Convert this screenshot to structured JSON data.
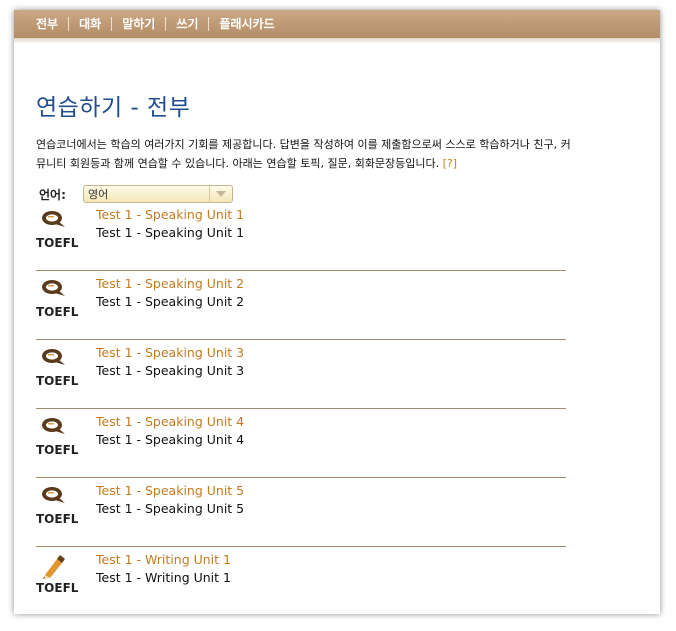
{
  "nav": {
    "items": [
      "전부",
      "대화",
      "말하기",
      "쓰기",
      "플래시카드"
    ]
  },
  "page": {
    "title": "연습하기 - 전부",
    "intro_line1": "연습코너에서는 학습의 여러가지 기회를 제공합니다. 답변을 작성하여 이를 제출함으로써 스스로 학습하거나 친구, 커",
    "intro_line2": "뮤니티 회원등과 함께 연습할 수 있습니다. 아래는 연습할 토픽, 질문, 회화문장등입니다.",
    "help_link": "[?]"
  },
  "language": {
    "label": "언어:",
    "selected": "영어"
  },
  "items": [
    {
      "icon": "speech-bubble-icon",
      "type": "TOEFL",
      "title": "Test 1 - Speaking Unit 1",
      "subtitle": "Test 1 - Speaking Unit 1"
    },
    {
      "icon": "speech-bubble-icon",
      "type": "TOEFL",
      "title": "Test 1 - Speaking Unit 2",
      "subtitle": "Test 1 - Speaking Unit 2"
    },
    {
      "icon": "speech-bubble-icon",
      "type": "TOEFL",
      "title": "Test 1 - Speaking Unit 3",
      "subtitle": "Test 1 - Speaking Unit 3"
    },
    {
      "icon": "speech-bubble-icon",
      "type": "TOEFL",
      "title": "Test 1 - Speaking Unit 4",
      "subtitle": "Test 1 - Speaking Unit 4"
    },
    {
      "icon": "speech-bubble-icon",
      "type": "TOEFL",
      "title": "Test 1 - Speaking Unit 5",
      "subtitle": "Test 1 - Speaking Unit 5"
    },
    {
      "icon": "pencil-icon",
      "type": "TOEFL",
      "title": "Test 1 - Writing Unit 1",
      "subtitle": "Test 1 - Writing Unit 1"
    }
  ],
  "colors": {
    "nav_bg": "#b38d66",
    "title": "#1f4e8c",
    "link": "#c47a1d",
    "divider": "#a38b70"
  }
}
